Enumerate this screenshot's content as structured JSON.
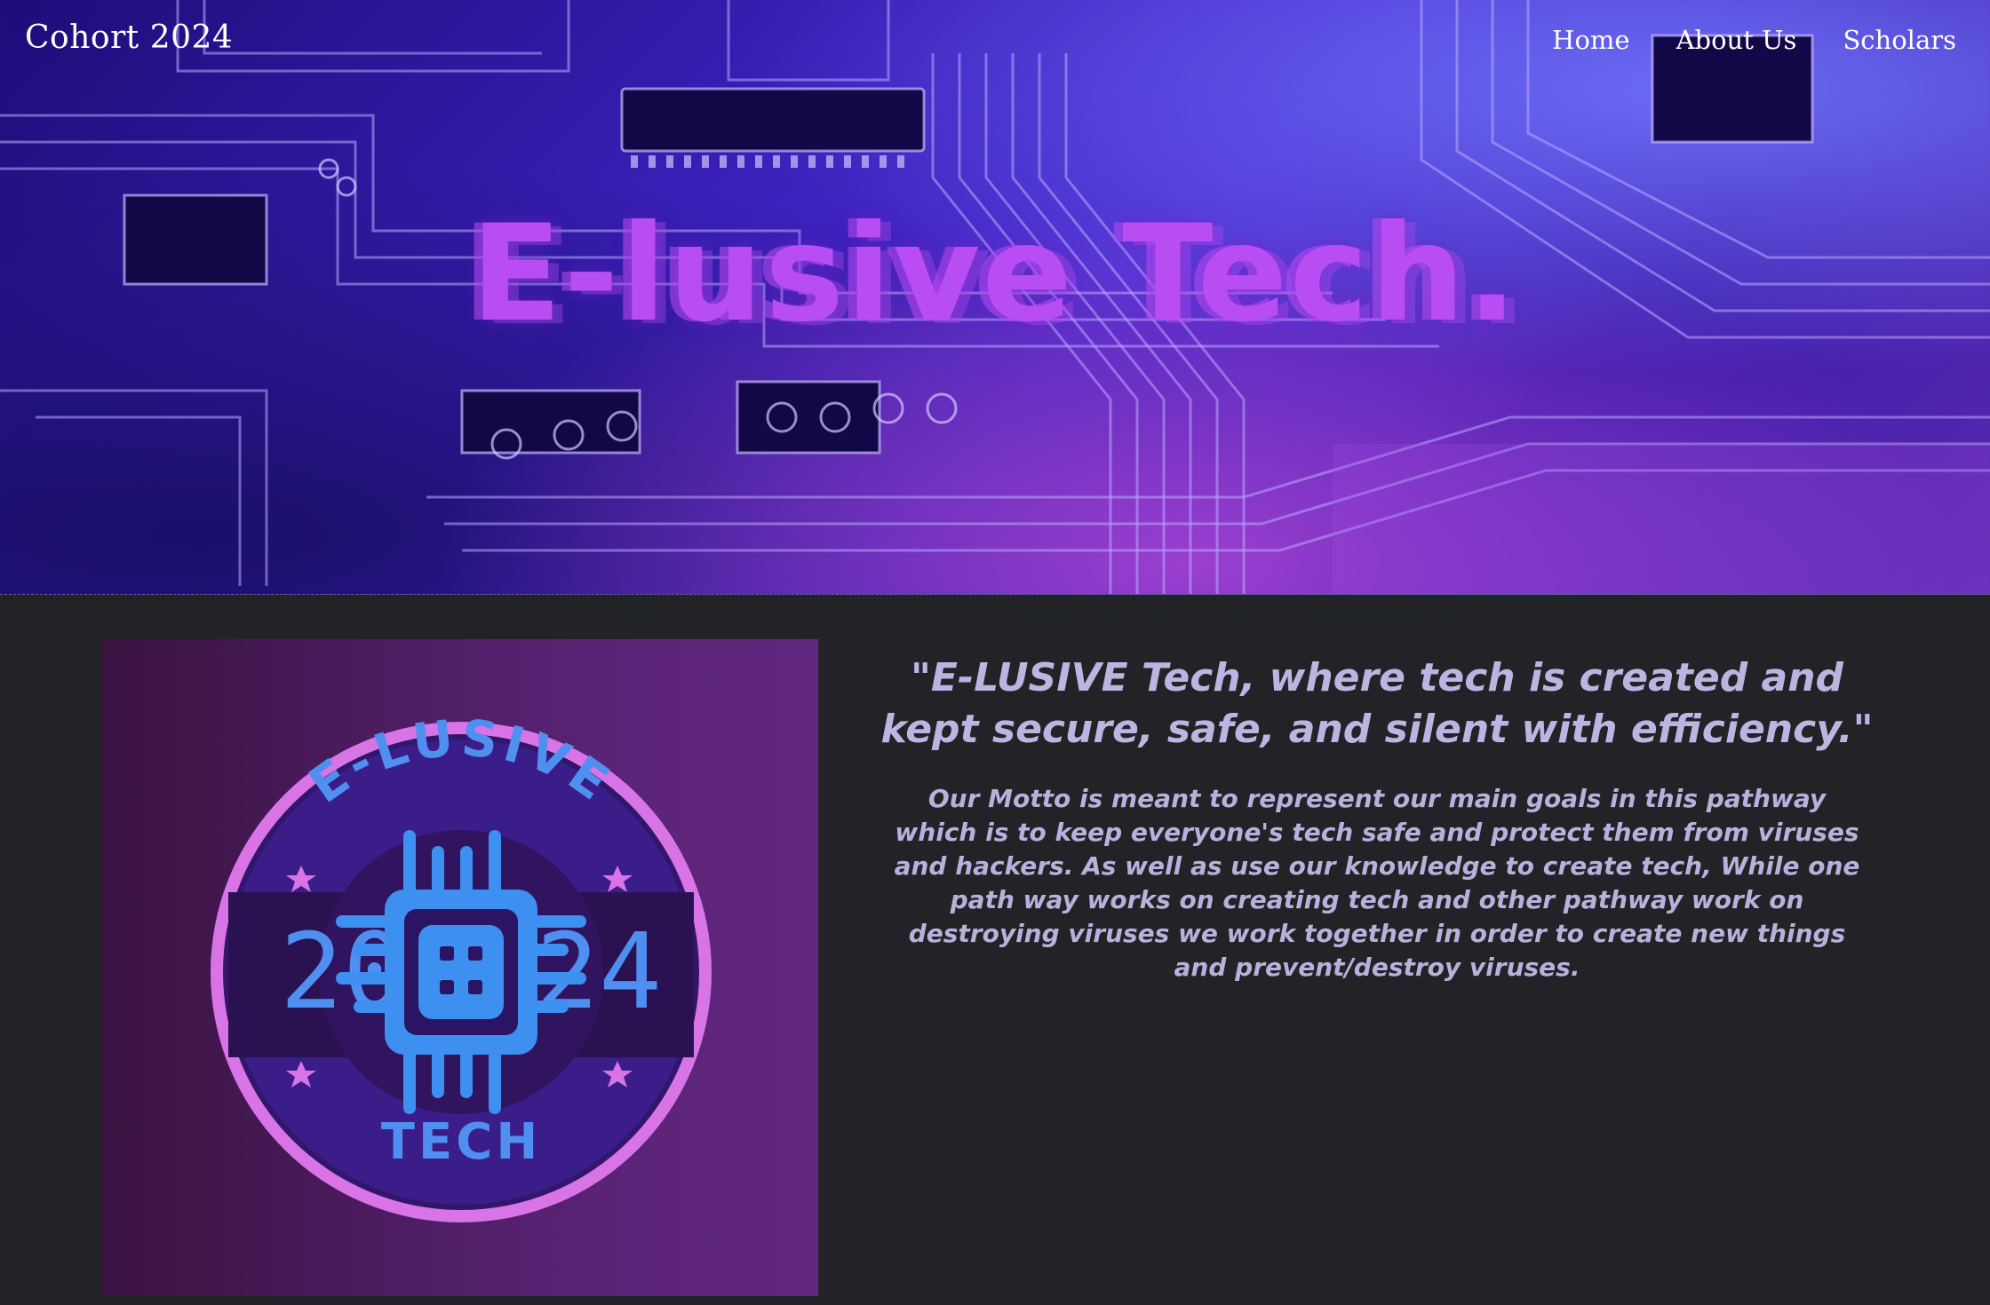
{
  "nav": {
    "brand": "Cohort 2024",
    "links": [
      {
        "label": "Home"
      },
      {
        "label": "About Us"
      },
      {
        "label": "Scholars"
      }
    ]
  },
  "hero": {
    "title": "E-lusive Tech."
  },
  "logo": {
    "top_text": "E-LUSIVE",
    "bottom_text": "TECH",
    "year_left": "20",
    "year_right": "24"
  },
  "content": {
    "motto": "\"E-LUSIVE  Tech, where tech is created and kept secure, safe, and silent with efficiency.\"",
    "description": "Our Motto is meant to represent our main goals in this pathway which is to keep     everyone's tech safe and protect them from viruses and hackers. As well as  use  our knowledge to create tech, While one path way works on creating tech  and other  pathway work on  destroying viruses  we work together in order to create new things and prevent/destroy viruses."
  },
  "colors": {
    "page_bg": "#212326",
    "hero_title": "#b74df2",
    "text": "#bcb3e0",
    "logo_ring": "#d874e6",
    "logo_chip": "#3d8ff0"
  }
}
